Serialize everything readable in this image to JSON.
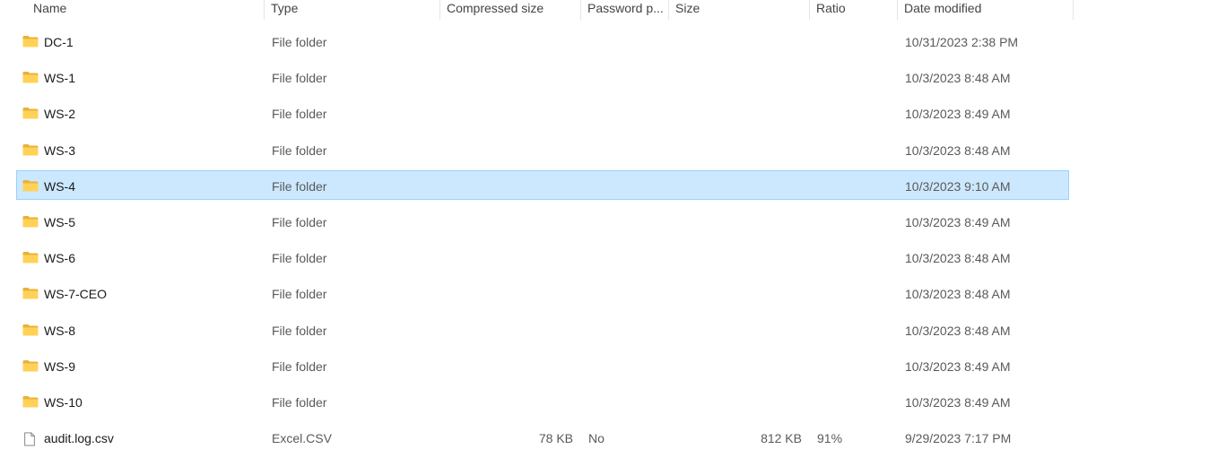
{
  "columns": {
    "name": "Name",
    "type": "Type",
    "compressed_size": "Compressed size",
    "password": "Password p...",
    "size": "Size",
    "ratio": "Ratio",
    "date_modified": "Date modified"
  },
  "files": [
    {
      "name": "DC-1",
      "type": "File folder",
      "compressed_size": "",
      "password": "",
      "size": "",
      "ratio": "",
      "date_modified": "10/31/2023 2:38 PM",
      "icon": "folder-icon",
      "selected": false
    },
    {
      "name": "WS-1",
      "type": "File folder",
      "compressed_size": "",
      "password": "",
      "size": "",
      "ratio": "",
      "date_modified": "10/3/2023 8:48 AM",
      "icon": "folder-icon",
      "selected": false
    },
    {
      "name": "WS-2",
      "type": "File folder",
      "compressed_size": "",
      "password": "",
      "size": "",
      "ratio": "",
      "date_modified": "10/3/2023 8:49 AM",
      "icon": "folder-icon",
      "selected": false
    },
    {
      "name": "WS-3",
      "type": "File folder",
      "compressed_size": "",
      "password": "",
      "size": "",
      "ratio": "",
      "date_modified": "10/3/2023 8:48 AM",
      "icon": "folder-icon",
      "selected": false
    },
    {
      "name": "WS-4",
      "type": "File folder",
      "compressed_size": "",
      "password": "",
      "size": "",
      "ratio": "",
      "date_modified": "10/3/2023 9:10 AM",
      "icon": "folder-icon",
      "selected": true
    },
    {
      "name": "WS-5",
      "type": "File folder",
      "compressed_size": "",
      "password": "",
      "size": "",
      "ratio": "",
      "date_modified": "10/3/2023 8:49 AM",
      "icon": "folder-icon",
      "selected": false
    },
    {
      "name": "WS-6",
      "type": "File folder",
      "compressed_size": "",
      "password": "",
      "size": "",
      "ratio": "",
      "date_modified": "10/3/2023 8:48 AM",
      "icon": "folder-icon",
      "selected": false
    },
    {
      "name": "WS-7-CEO",
      "type": "File folder",
      "compressed_size": "",
      "password": "",
      "size": "",
      "ratio": "",
      "date_modified": "10/3/2023 8:48 AM",
      "icon": "folder-icon",
      "selected": false
    },
    {
      "name": "WS-8",
      "type": "File folder",
      "compressed_size": "",
      "password": "",
      "size": "",
      "ratio": "",
      "date_modified": "10/3/2023 8:48 AM",
      "icon": "folder-icon",
      "selected": false
    },
    {
      "name": "WS-9",
      "type": "File folder",
      "compressed_size": "",
      "password": "",
      "size": "",
      "ratio": "",
      "date_modified": "10/3/2023 8:49 AM",
      "icon": "folder-icon",
      "selected": false
    },
    {
      "name": "WS-10",
      "type": "File folder",
      "compressed_size": "",
      "password": "",
      "size": "",
      "ratio": "",
      "date_modified": "10/3/2023 8:49 AM",
      "icon": "folder-icon",
      "selected": false
    },
    {
      "name": "audit.log.csv",
      "type": "Excel.CSV",
      "compressed_size": "78 KB",
      "password": "No",
      "size": "812 KB",
      "ratio": "91%",
      "date_modified": "9/29/2023 7:17 PM",
      "icon": "file-icon",
      "selected": false
    }
  ],
  "colors": {
    "selection_bg": "#cce8ff",
    "selection_border": "#99d1ff",
    "folder_yellow": "#ffd257"
  }
}
